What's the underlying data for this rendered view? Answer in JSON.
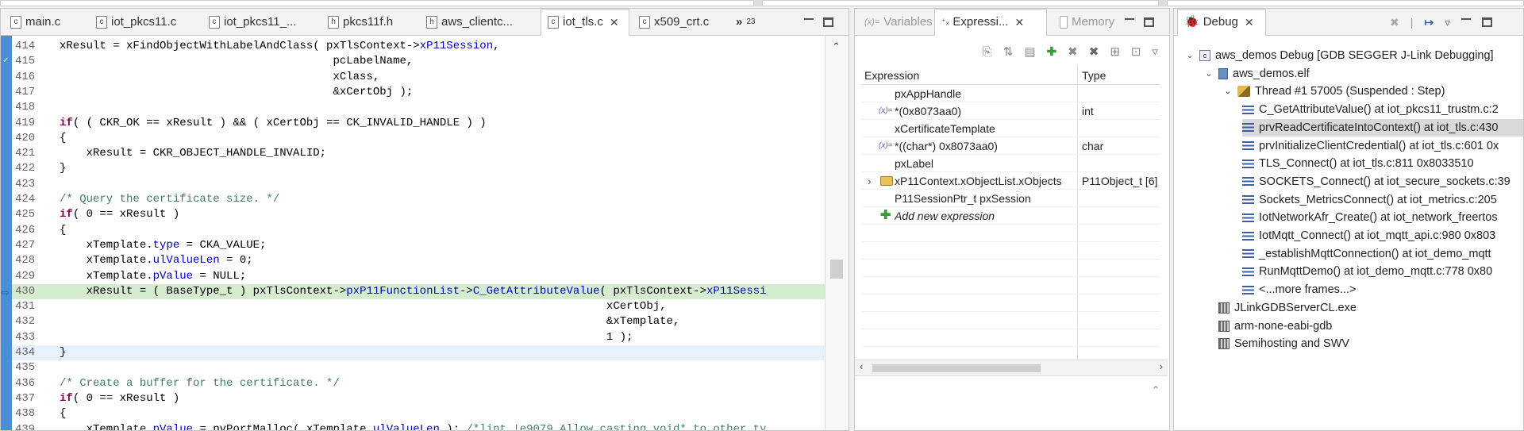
{
  "editor": {
    "tabs": [
      {
        "label": "main.c",
        "icon": "c"
      },
      {
        "label": "iot_pkcs11.c",
        "icon": "c"
      },
      {
        "label": "iot_pkcs11_...",
        "icon": "c"
      },
      {
        "label": "pkcs11f.h",
        "icon": "h"
      },
      {
        "label": "aws_clientc...",
        "icon": "h"
      },
      {
        "label": "iot_tls.c",
        "icon": "c",
        "active": true
      },
      {
        "label": "x509_crt.c",
        "icon": "c"
      }
    ],
    "overflow": "»",
    "overflow_count": "23",
    "lines": [
      {
        "n": "414",
        "t": "xResult = xFindObjectWithLabelAndClass( pxTlsContext->xP11Session,"
      },
      {
        "n": "415",
        "t": "                                         pcLabelName,"
      },
      {
        "n": "416",
        "t": "                                         xClass,"
      },
      {
        "n": "417",
        "t": "                                         &xCertObj );"
      },
      {
        "n": "418",
        "t": ""
      },
      {
        "n": "419",
        "t": "if( ( CKR_OK == xResult ) && ( xCertObj == CK_INVALID_HANDLE ) )"
      },
      {
        "n": "420",
        "t": "{"
      },
      {
        "n": "421",
        "t": "    xResult = CKR_OBJECT_HANDLE_INVALID;"
      },
      {
        "n": "422",
        "t": "}"
      },
      {
        "n": "423",
        "t": ""
      },
      {
        "n": "424",
        "t": "/* Query the certificate size. */"
      },
      {
        "n": "425",
        "t": "if( 0 == xResult )"
      },
      {
        "n": "426",
        "t": "{"
      },
      {
        "n": "427",
        "t": "    xTemplate.type = CKA_VALUE;"
      },
      {
        "n": "428",
        "t": "    xTemplate.ulValueLen = 0;"
      },
      {
        "n": "429",
        "t": "    xTemplate.pValue = NULL;"
      },
      {
        "n": "430",
        "t": "    xResult = ( BaseType_t ) pxTlsContext->pxP11FunctionList->C_GetAttributeValue( pxTlsContext->xP11Sessi"
      },
      {
        "n": "431",
        "t": "                                                                                  xCertObj,"
      },
      {
        "n": "432",
        "t": "                                                                                  &xTemplate,"
      },
      {
        "n": "433",
        "t": "                                                                                  1 );"
      },
      {
        "n": "434",
        "t": "}"
      },
      {
        "n": "435",
        "t": ""
      },
      {
        "n": "436",
        "t": "/* Create a buffer for the certificate. */"
      },
      {
        "n": "437",
        "t": "if( 0 == xResult )"
      },
      {
        "n": "438",
        "t": "{"
      },
      {
        "n": "439",
        "t": "    xTemplate.pValue = pvPortMalloc( xTemplate.ulValueLen ); /*lint !e9079 Allow casting void* to other ty"
      }
    ]
  },
  "views": {
    "tabs": [
      {
        "label": "Variables",
        "icon": "(x)="
      },
      {
        "label": "Expressi...",
        "icon": "x+y",
        "active": true
      },
      {
        "label": "Memory",
        "icon": "[]"
      }
    ],
    "columns": {
      "expression": "Expression",
      "type": "Type"
    },
    "expressions": [
      {
        "name": "pxAppHandle",
        "type": "",
        "icon": ""
      },
      {
        "name": "*(0x8073aa0)",
        "type": "int",
        "icon": "(x)="
      },
      {
        "name": "xCertificateTemplate",
        "type": "",
        "icon": ""
      },
      {
        "name": "*((char*) 0x8073aa0)",
        "type": "char",
        "icon": "(x)="
      },
      {
        "name": "pxLabel",
        "type": "",
        "icon": ""
      },
      {
        "name": "xP11Context.xObjectList.xObjects",
        "type": "P11Object_t [6]",
        "icon": "obj"
      },
      {
        "name": "P11SessionPtr_t pxSession",
        "type": "",
        "icon": ""
      }
    ],
    "add_expression": "Add new expression"
  },
  "debug": {
    "tab": "Debug",
    "tree": [
      {
        "level": 0,
        "label": "aws_demos Debug [GDB SEGGER J-Link Debugging]",
        "icon": "launch",
        "expanded": true
      },
      {
        "level": 1,
        "label": "aws_demos.elf",
        "icon": "elf",
        "expanded": true
      },
      {
        "level": 2,
        "label": "Thread #1 57005 (Suspended : Step)",
        "icon": "thread",
        "expanded": true
      },
      {
        "level": 3,
        "label": "C_GetAttributeValue() at iot_pkcs11_trustm.c:2",
        "icon": "frame"
      },
      {
        "level": 3,
        "label": "prvReadCertificateIntoContext() at iot_tls.c:430",
        "icon": "frame",
        "selected": true
      },
      {
        "level": 3,
        "label": "prvInitializeClientCredential() at iot_tls.c:601 0x",
        "icon": "frame"
      },
      {
        "level": 3,
        "label": "TLS_Connect() at iot_tls.c:811 0x8033510",
        "icon": "frame"
      },
      {
        "level": 3,
        "label": "SOCKETS_Connect() at iot_secure_sockets.c:39",
        "icon": "frame"
      },
      {
        "level": 3,
        "label": "Sockets_MetricsConnect() at iot_metrics.c:205",
        "icon": "frame"
      },
      {
        "level": 3,
        "label": "IotNetworkAfr_Create() at iot_network_freertos",
        "icon": "frame"
      },
      {
        "level": 3,
        "label": "IotMqtt_Connect() at iot_mqtt_api.c:980 0x803",
        "icon": "frame"
      },
      {
        "level": 3,
        "label": "_establishMqttConnection() at iot_demo_mqtt",
        "icon": "frame"
      },
      {
        "level": 3,
        "label": "RunMqttDemo() at iot_demo_mqtt.c:778 0x80",
        "icon": "frame"
      },
      {
        "level": 3,
        "label": "<...more frames...>",
        "icon": "frame"
      },
      {
        "level": 1,
        "label": "JLinkGDBServerCL.exe",
        "icon": "process"
      },
      {
        "level": 1,
        "label": "arm-none-eabi-gdb",
        "icon": "process"
      },
      {
        "level": 1,
        "label": "Semihosting and SWV",
        "icon": "process"
      }
    ]
  }
}
